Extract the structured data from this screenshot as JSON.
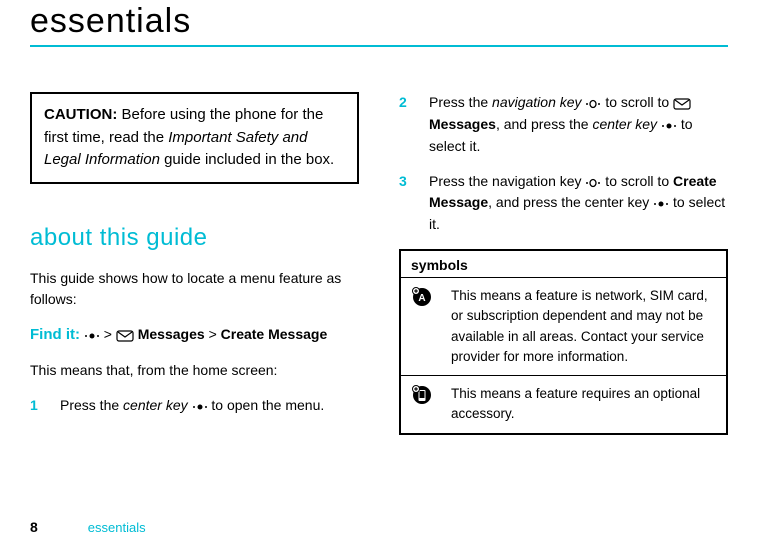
{
  "page": {
    "title": "essentials",
    "caution": {
      "label": "CAUTION:",
      "text_before": "Before using the phone for the first time, read the ",
      "italic": "Important Safety and Legal Information",
      "text_after": " guide included in the box."
    },
    "heading": "about this guide",
    "intro": "This guide shows how to locate a menu feature as follows:",
    "find_it": {
      "label": "Find it:",
      "messages": "Messages",
      "sep": ">",
      "create": "Create Message"
    },
    "means": "This means that, from the home screen:",
    "steps": {
      "s1_num": "1",
      "s1_a": "Press the ",
      "s1_i": "center key",
      "s1_b": " to open the menu.",
      "s2_num": "2",
      "s2_a": "Press the ",
      "s2_i1": "navigation key",
      "s2_b": " to scroll to ",
      "s2_msg": "Messages",
      "s2_c": ", and press the ",
      "s2_i2": "center key",
      "s2_d": " to select it.",
      "s3_num": "3",
      "s3_a": "Press the navigation key ",
      "s3_b": " to scroll to ",
      "s3_create": "Create Message",
      "s3_c": ", and press the center key ",
      "s3_d": " to select it."
    },
    "symbols": {
      "header": "symbols",
      "row1": "This means a feature is network, SIM card, or subscription dependent and may not be available in all areas. Contact your service provider for more information.",
      "row2": "This means a feature requires an optional accessory."
    },
    "footer": {
      "page_num": "8",
      "label": "essentials"
    }
  }
}
